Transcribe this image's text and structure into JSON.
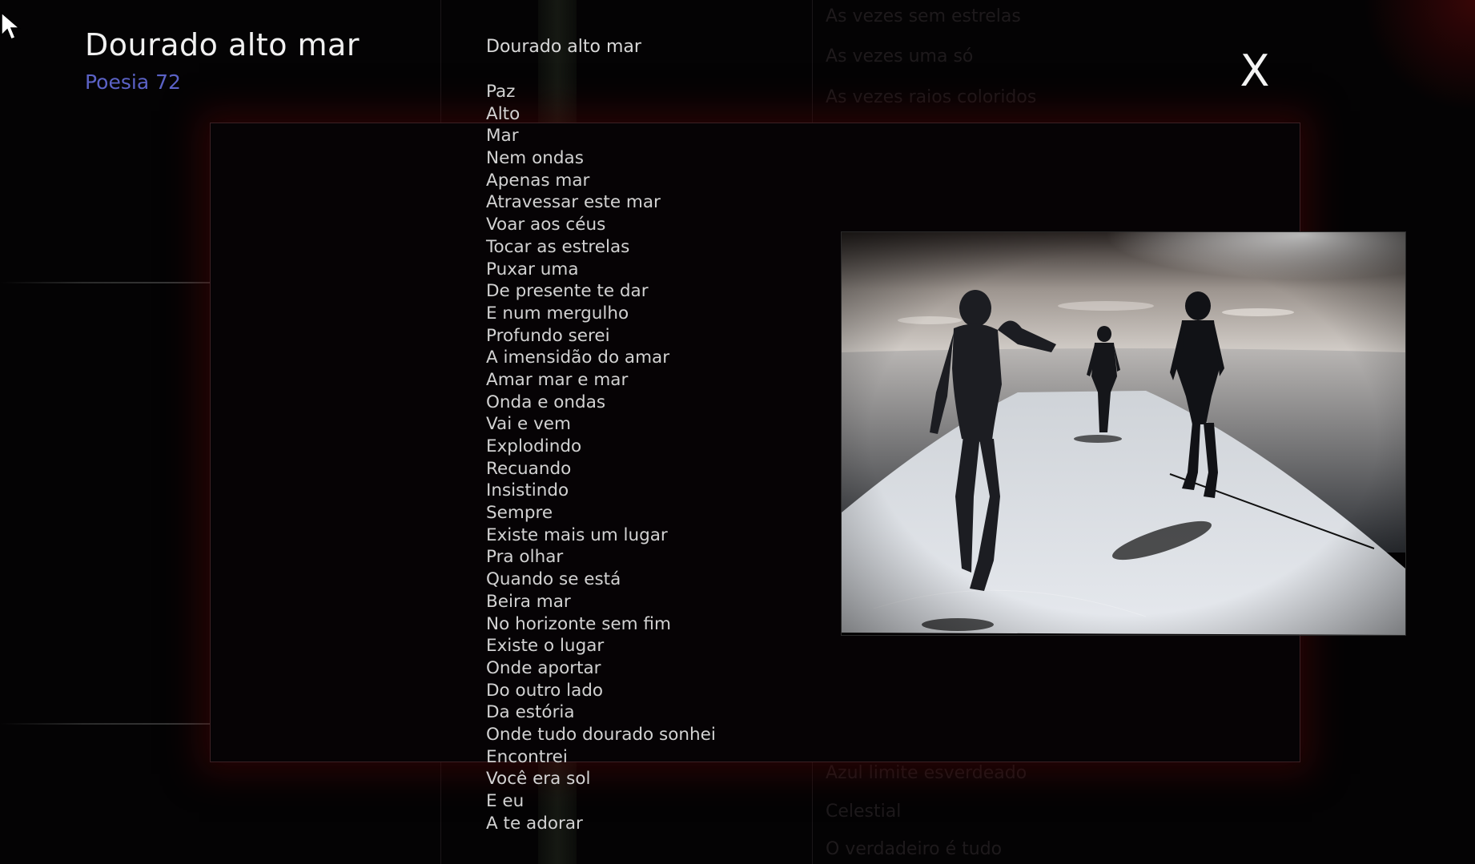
{
  "header": {
    "title": "Dourado alto mar",
    "subtitle": "Poesia 72"
  },
  "background_text": {
    "top": [
      "As vezes sem estrelas",
      "As vezes uma só",
      "As vezes raios coloridos"
    ],
    "bottom": [
      "Azul limite esverdeado",
      "Celestial",
      "O verdadeiro é tudo"
    ]
  },
  "poem": {
    "title": "Dourado alto mar",
    "lines": [
      "Paz",
      "Alto",
      "Mar",
      "Nem ondas",
      "Apenas mar",
      "Atravessar este mar",
      "Voar aos céus",
      "Tocar as estrelas",
      "Puxar uma",
      "De presente te dar",
      "E num mergulho",
      "Profundo serei",
      "A imensidão do amar",
      "Amar mar e mar",
      "Onda e ondas",
      "Vai e vem",
      "Explodindo",
      "Recuando",
      "Insistindo",
      "Sempre",
      "Existe mais um lugar",
      "Pra olhar",
      "Quando se está",
      "Beira mar",
      "No horizonte sem fim",
      "Existe o lugar",
      "Onde aportar",
      "Do outro lado",
      "Da estória",
      "Onde tudo dourado sonhei",
      "Encontrei",
      "Você era sol",
      "E eu",
      "A te adorar"
    ]
  },
  "close_label": "X",
  "colors": {
    "background": "#040304",
    "title": "#f1f1f1",
    "subtitle": "#5b62c6",
    "poem_text": "#d2d2d2",
    "panel_glow": "#460606"
  }
}
